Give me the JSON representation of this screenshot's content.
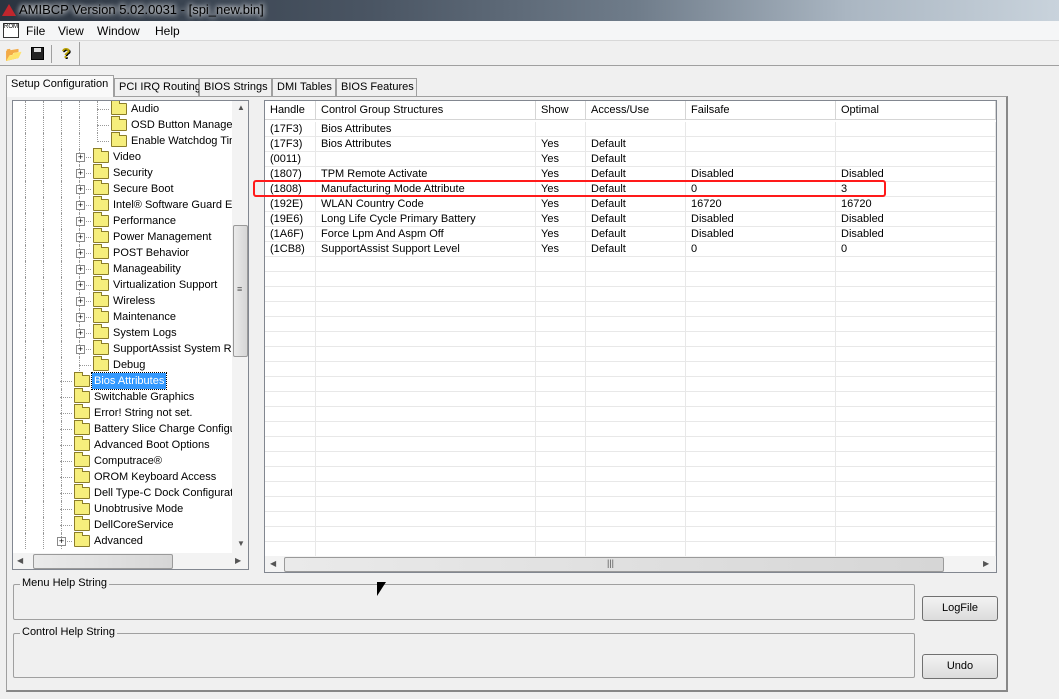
{
  "window": {
    "title": "AMIBCP Version 5.02.0031 - [spi_new.bin]",
    "app_icon": "ami-logo-icon"
  },
  "menu": [
    "File",
    "View",
    "Window",
    "Help"
  ],
  "toolbar": {
    "open": "open-folder-icon",
    "save": "floppy-save-icon",
    "help": "question-help-icon"
  },
  "tabs": [
    "Setup Configuration",
    "PCI IRQ Routing",
    "BIOS Strings",
    "DMI Tables",
    "BIOS Features"
  ],
  "tree": [
    {
      "label": "Audio",
      "level": 3,
      "expander": false
    },
    {
      "label": "OSD Button Manager",
      "level": 3,
      "expander": false
    },
    {
      "label": "Enable Watchdog Tin",
      "level": 3,
      "expander": false
    },
    {
      "label": "Video",
      "level": 2,
      "expander": true
    },
    {
      "label": "Security",
      "level": 2,
      "expander": true
    },
    {
      "label": "Secure Boot",
      "level": 2,
      "expander": true
    },
    {
      "label": "Intel® Software Guard E:",
      "level": 2,
      "expander": true
    },
    {
      "label": "Performance",
      "level": 2,
      "expander": true
    },
    {
      "label": "Power Management",
      "level": 2,
      "expander": true
    },
    {
      "label": "POST Behavior",
      "level": 2,
      "expander": true
    },
    {
      "label": "Manageability",
      "level": 2,
      "expander": true
    },
    {
      "label": "Virtualization Support",
      "level": 2,
      "expander": true
    },
    {
      "label": "Wireless",
      "level": 2,
      "expander": true
    },
    {
      "label": "Maintenance",
      "level": 2,
      "expander": true
    },
    {
      "label": "System Logs",
      "level": 2,
      "expander": true
    },
    {
      "label": "SupportAssist System R",
      "level": 2,
      "expander": true
    },
    {
      "label": "Debug",
      "level": 2,
      "expander": false
    },
    {
      "label": "Bios Attributes",
      "level": 1,
      "expander": false,
      "selected": true
    },
    {
      "label": "Switchable Graphics",
      "level": 1,
      "expander": false
    },
    {
      "label": "Error! String not set.",
      "level": 1,
      "expander": false
    },
    {
      "label": "Battery Slice Charge Configu",
      "level": 1,
      "expander": false
    },
    {
      "label": "Advanced Boot Options",
      "level": 1,
      "expander": false
    },
    {
      "label": "Computrace®",
      "level": 1,
      "expander": false
    },
    {
      "label": "OROM Keyboard Access",
      "level": 1,
      "expander": false
    },
    {
      "label": "Dell Type-C Dock Configurati",
      "level": 1,
      "expander": false
    },
    {
      "label": "Unobtrusive Mode",
      "level": 1,
      "expander": false
    },
    {
      "label": "DellCoreService",
      "level": 1,
      "expander": false
    },
    {
      "label": "Advanced",
      "level": 1,
      "expander": true
    }
  ],
  "grid": {
    "columns": [
      "Handle",
      "Control Group Structures",
      "Show",
      "Access/Use",
      "Failsafe",
      "Optimal"
    ],
    "rows": [
      [
        "(17F3)",
        "Bios Attributes",
        "",
        "",
        "",
        ""
      ],
      [
        "(17F3)",
        "Bios Attributes",
        "Yes",
        "Default",
        "",
        ""
      ],
      [
        "(0011)",
        "",
        "Yes",
        "Default",
        "",
        ""
      ],
      [
        "(1807)",
        "TPM Remote Activate",
        "Yes",
        "Default",
        "Disabled",
        "Disabled"
      ],
      [
        "(1808)",
        "Manufacturing Mode Attribute",
        "Yes",
        "Default",
        "0",
        "3"
      ],
      [
        "(192E)",
        "WLAN Country Code",
        "Yes",
        "Default",
        "16720",
        "16720"
      ],
      [
        "(19E6)",
        "Long Life Cycle Primary Battery",
        "Yes",
        "Default",
        "Disabled",
        "Disabled"
      ],
      [
        "(1A6F)",
        "Force Lpm And Aspm Off",
        "Yes",
        "Default",
        "Disabled",
        "Disabled"
      ],
      [
        "(1CB8)",
        "SupportAssist Support Level",
        "Yes",
        "Default",
        "0",
        "0"
      ]
    ],
    "highlighted_row": 4,
    "highlight_color": "#ff1a1a"
  },
  "help": {
    "menu_label": "Menu Help String",
    "control_label": "Control Help String"
  },
  "buttons": {
    "logfile": "LogFile",
    "undo": "Undo"
  }
}
